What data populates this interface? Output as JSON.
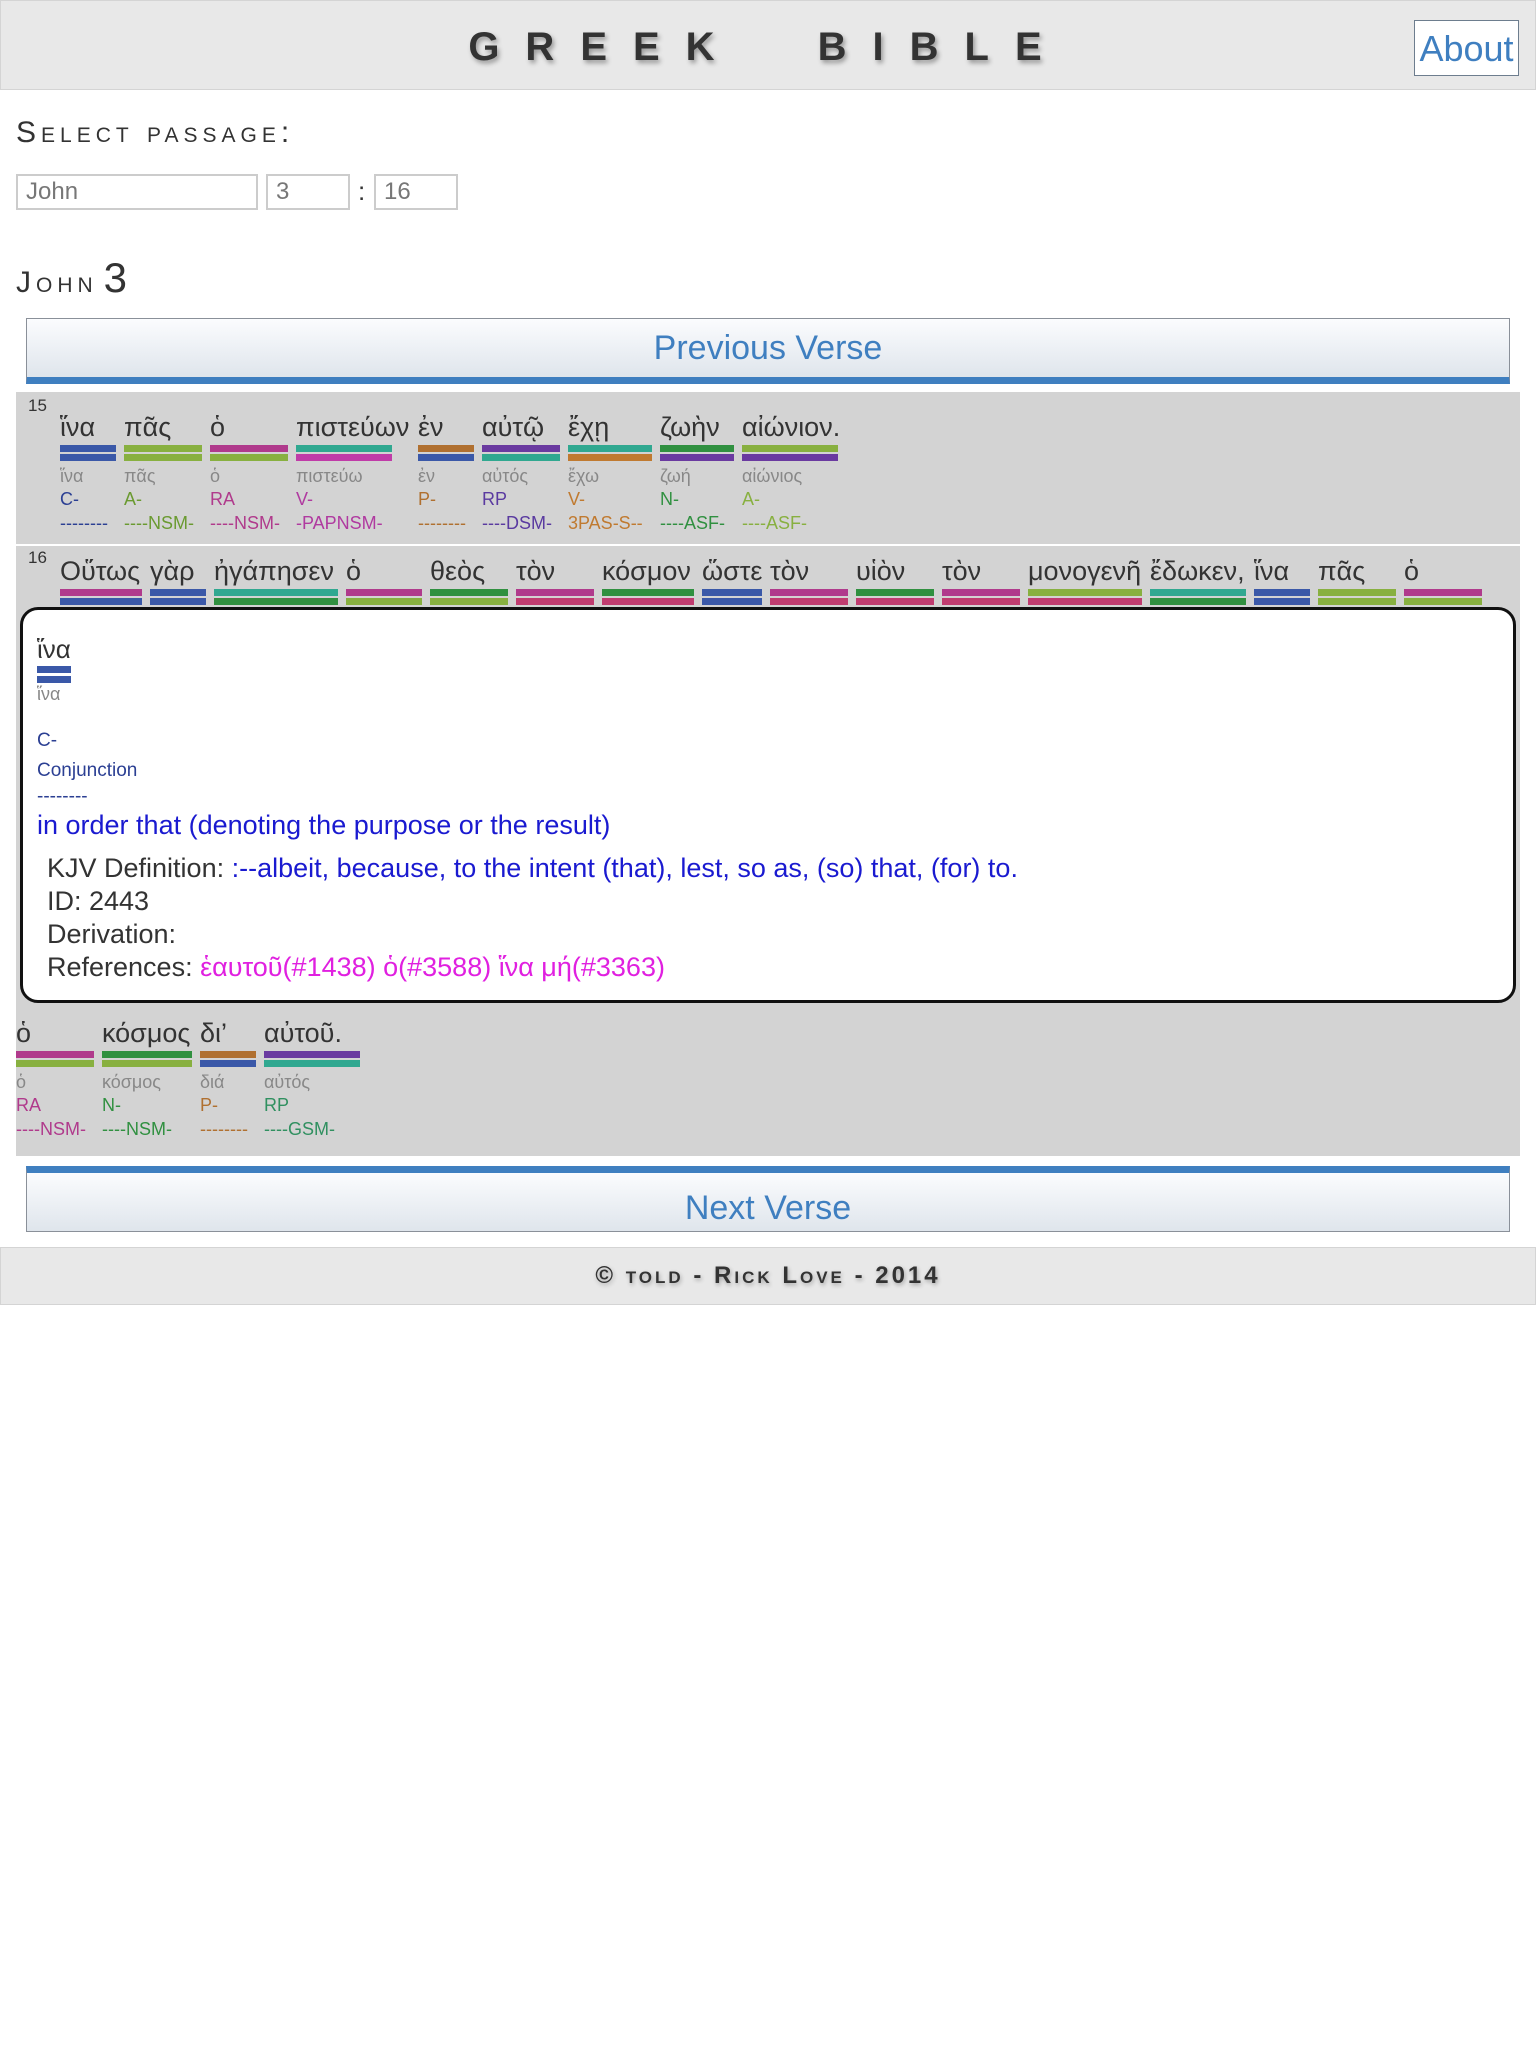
{
  "header": {
    "title": "GREEK  BIBLE",
    "about_label": "About"
  },
  "passage": {
    "label": "Select passage:",
    "book": "John",
    "chapter": "3",
    "verse": "16",
    "separator": ":"
  },
  "chapter_heading": {
    "book": "John",
    "number": "3"
  },
  "nav": {
    "previous": "Previous Verse",
    "next": "Next Verse"
  },
  "colors": {
    "conjunction": "#3a58a8",
    "adjective": "#88b040",
    "article": "#b03a8c",
    "verb": "#c03ca8",
    "preposition": "#b07030",
    "pronoun": "#6a3aa0",
    "noun": "#309040",
    "teal": "#30a890"
  },
  "verse15": {
    "number": "15",
    "words": [
      {
        "greek": "ἵνα",
        "lemma": "ἵνα",
        "pos": "C-",
        "parse": "--------",
        "c1": "#3a58a8",
        "c2": "#3a58a8",
        "pc": "#2b3f93"
      },
      {
        "greek": "πᾶς",
        "lemma": "πᾶς",
        "pos": "A-",
        "parse": "----NSM-",
        "c1": "#88b040",
        "c2": "#88b040",
        "pc": "#6a9a30"
      },
      {
        "greek": "ὁ",
        "lemma": "ὁ",
        "pos": "RA",
        "parse": "----NSM-",
        "c1": "#b03a8c",
        "c2": "#88b040",
        "pc": "#b03a8c"
      },
      {
        "greek": "πιστεύων",
        "lemma": "πιστεύω",
        "pos": "V-",
        "parse": "-PAPNSM-",
        "c1": "#30a890",
        "c2": "#c03ca8",
        "pc": "#b03aa0"
      },
      {
        "greek": "ἐν",
        "lemma": "ἐν",
        "pos": "P-",
        "parse": "--------",
        "c1": "#b07030",
        "c2": "#3a58a8",
        "pc": "#b07030"
      },
      {
        "greek": "αὐτῷ",
        "lemma": "αὐτός",
        "pos": "RP",
        "parse": "----DSM-",
        "c1": "#6a3aa0",
        "c2": "#30a890",
        "pc": "#5a3aa0"
      },
      {
        "greek": "ἔχῃ",
        "lemma": "ἔχω",
        "pos": "V-",
        "parse": "3PAS-S--",
        "c1": "#30a890",
        "c2": "#c07a30",
        "pc": "#c07a30"
      },
      {
        "greek": "ζωὴν",
        "lemma": "ζωή",
        "pos": "N-",
        "parse": "----ASF-",
        "c1": "#309040",
        "c2": "#6a3aa0",
        "pc": "#309040"
      },
      {
        "greek": "αἰώνιον.",
        "lemma": "αἰώνιος",
        "pos": "A-",
        "parse": "----ASF-",
        "c1": "#88b040",
        "c2": "#6a3aa0",
        "pc": "#88b040"
      }
    ]
  },
  "verse16": {
    "number": "16",
    "words": [
      "Οὕτως",
      "γὰρ",
      "ἠγάπησεν",
      "ὁ",
      "θεὸς",
      "τὸν",
      "κόσμον",
      "ὥστε",
      "τὸν",
      "υἱὸν",
      "τὸν",
      "μονογενῆ",
      "ἔδωκεν,",
      "ἵνα",
      "πᾶς",
      "ὁ"
    ]
  },
  "verse_tail": {
    "words": [
      {
        "greek": "ὁ",
        "lemma": "ὁ",
        "pos": "RA",
        "parse": "----NSM-",
        "c1": "#b03a8c",
        "c2": "#88b040",
        "pc": "#b03a8c"
      },
      {
        "greek": "κόσμος",
        "lemma": "κόσμος",
        "pos": "N-",
        "parse": "----NSM-",
        "c1": "#309040",
        "c2": "#88b040",
        "pc": "#309040"
      },
      {
        "greek": "δι’",
        "lemma": "διά",
        "pos": "P-",
        "parse": "--------",
        "c1": "#b07030",
        "c2": "#3a58a8",
        "pc": "#b07030"
      },
      {
        "greek": "αὐτοῦ.",
        "lemma": "αὐτός",
        "pos": "RP",
        "parse": "----GSM-",
        "c1": "#6a3aa0",
        "c2": "#30a890",
        "pc": "#309060"
      }
    ]
  },
  "popup": {
    "word": "ἵνα",
    "lemma": "ἵνα",
    "pos_code": "C-",
    "pos_name": "Conjunction",
    "parse": "--------",
    "definition": "in order that (denoting the purpose or the result)",
    "kjv_label": "KJV Definition: ",
    "kjv_value": ":--albeit, because, to the intent (that), lest, so as, (so) that, (for) to.",
    "id_text": "ID: 2443",
    "derivation_label": "Derivation:",
    "references_label": "References: ",
    "references_value": "ἑαυτοῦ(#1438) ὁ(#3588) ἵνα μή(#3363)"
  },
  "footer": {
    "copyright": "©",
    "told": "told",
    "author": "Rick Love",
    "year": "2014",
    "dash": "-"
  }
}
